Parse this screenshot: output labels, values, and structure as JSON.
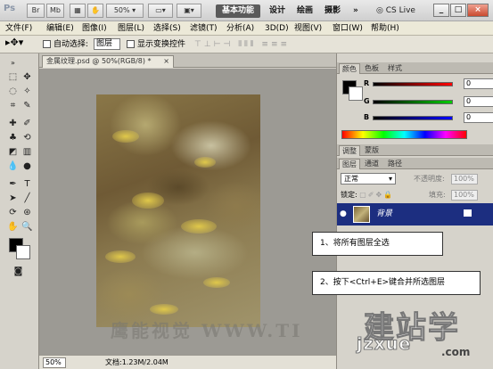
{
  "titlebar": {
    "app_logo": "Ps",
    "zoom": "50%",
    "workspaces": [
      "基本功能",
      "设计",
      "绘画",
      "摄影"
    ],
    "more": "»",
    "cs_live": "CS Live",
    "minimize": "_",
    "maximize": "□",
    "close": "×"
  },
  "menu": [
    "文件(F)",
    "编辑(E)",
    "图像(I)",
    "图层(L)",
    "选择(S)",
    "滤镜(T)",
    "分析(A)",
    "3D(D)",
    "视图(V)",
    "窗口(W)",
    "帮助(H)"
  ],
  "options": {
    "auto_select_label": "自动选择:",
    "auto_select_value": "图层",
    "show_transform_label": "显示变换控件"
  },
  "document": {
    "tab_title": "金属纹理.psd @ 50%(RGB/8) *",
    "tab_close": "×",
    "watermark": "鹰能视觉 WWW.TI"
  },
  "status": {
    "zoom": "50%",
    "doc_info": "文档:1.23M/2.04M"
  },
  "panels": {
    "color_tabs": [
      "颜色",
      "色板",
      "样式"
    ],
    "sliders": [
      {
        "label": "R",
        "value": "0",
        "color": "#d00000"
      },
      {
        "label": "G",
        "value": "0",
        "color": "#00a000"
      },
      {
        "label": "B",
        "value": "0",
        "color": "#0000d0"
      }
    ],
    "adjust_tabs": [
      "调整",
      "蒙版"
    ],
    "layer_tabs": [
      "图层",
      "通道",
      "路径"
    ],
    "blend_mode": "正常",
    "opacity_label": "不透明度:",
    "opacity_value": "100%",
    "lock_label": "锁定:",
    "fill_label": "填充:",
    "fill_value": "100%",
    "layer_name": "背景"
  },
  "callouts": {
    "step1": "1、将所有图层全选",
    "step2": "2、按下<Ctrl+E>键合并所选图层"
  },
  "watermark": {
    "logo": "建站学",
    "domain": "jzxue",
    "com": ".com"
  }
}
